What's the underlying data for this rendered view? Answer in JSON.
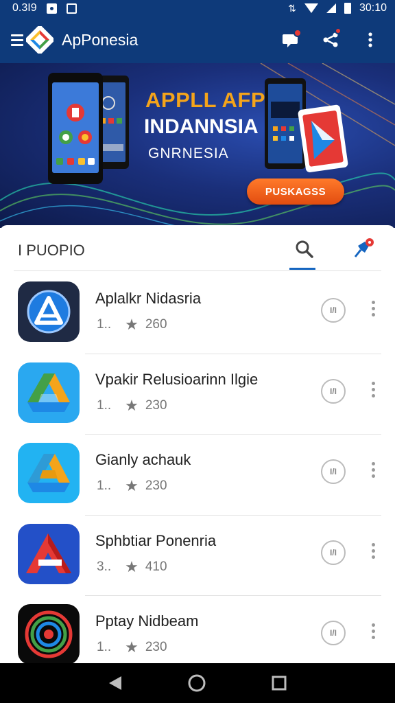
{
  "status_bar": {
    "time": "0.3I9",
    "clock": "30:10"
  },
  "app_bar": {
    "title": "ApPonesia"
  },
  "banner": {
    "line1": "APPLL AFP",
    "line2": "INDANNSIA",
    "line3": "GNRNESIA",
    "cta": "PUSKAGSS"
  },
  "section": {
    "title": "I PUOPIO"
  },
  "apps": [
    {
      "name": "Aplalkr Nidasria",
      "count": "1..",
      "rating": "260",
      "install_label": "I/I",
      "icon": "blue-ring-a-icon"
    },
    {
      "name": "Vpakir Relusioarinn Ilgie",
      "count": "1..",
      "rating": "230",
      "install_label": "I/I",
      "icon": "drive-triangle-icon"
    },
    {
      "name": "Gianly achauk",
      "count": "1..",
      "rating": "230",
      "install_label": "I/I",
      "icon": "drive-triangle-icon"
    },
    {
      "name": "Sphbtiar Ponenria",
      "count": "3..",
      "rating": "410",
      "install_label": "I/I",
      "icon": "red-a-icon"
    },
    {
      "name": "Pptay Nidbeam",
      "count": "1..",
      "rating": "230",
      "install_label": "I/I",
      "icon": "target-rings-icon"
    }
  ],
  "colors": {
    "primary": "#0e3a7a",
    "accent": "#1565c0",
    "cta_orange": "#e24c10",
    "badge_red": "#e53935"
  }
}
